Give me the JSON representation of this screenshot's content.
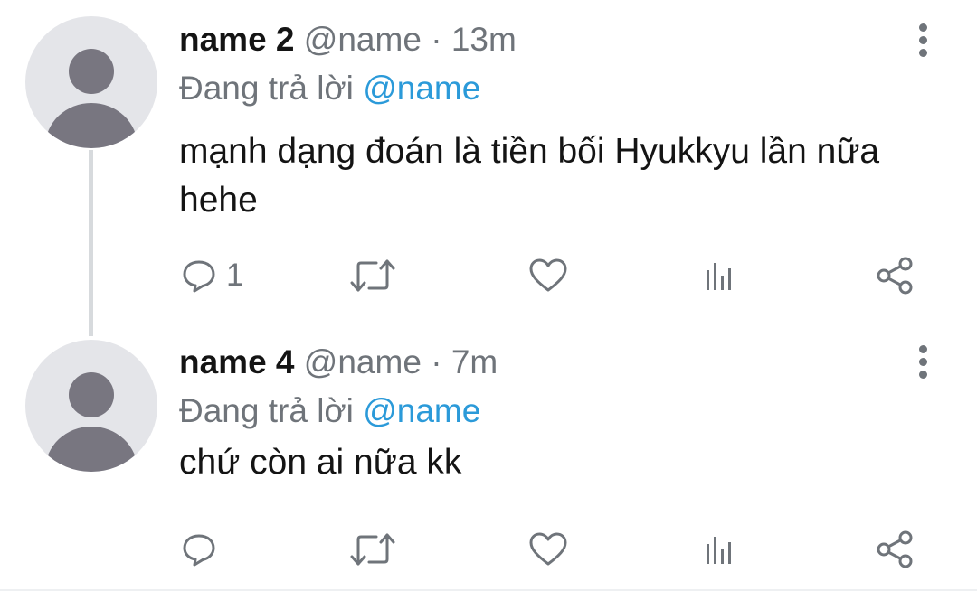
{
  "tweets": [
    {
      "name": "name 2",
      "handle": "@name",
      "separator": "·",
      "time": "13m",
      "replying_prefix": "Đang trả lời",
      "replying_to": "@name",
      "text": "mạnh dạng đoán là tiền bối Hyukkyu lần nữa hehe",
      "reply_count": "1",
      "icons": [
        "reply-icon",
        "retweet-icon",
        "like-icon",
        "analytics-icon",
        "share-icon",
        "more-icon"
      ]
    },
    {
      "name": "name 4",
      "handle": "@name",
      "separator": "·",
      "time": "7m",
      "replying_prefix": "Đang trả lời",
      "replying_to": "@name",
      "text": "chứ còn ai nữa kk",
      "reply_count": "",
      "icons": [
        "reply-icon",
        "retweet-icon",
        "like-icon",
        "analytics-icon",
        "share-icon",
        "more-icon"
      ]
    }
  ],
  "colors": {
    "mention": "#2b9ad9",
    "secondary_text": "#6f747a",
    "avatar_bg": "#e4e5e9",
    "avatar_fg": "#787680",
    "thread_line": "#d7dadd"
  }
}
